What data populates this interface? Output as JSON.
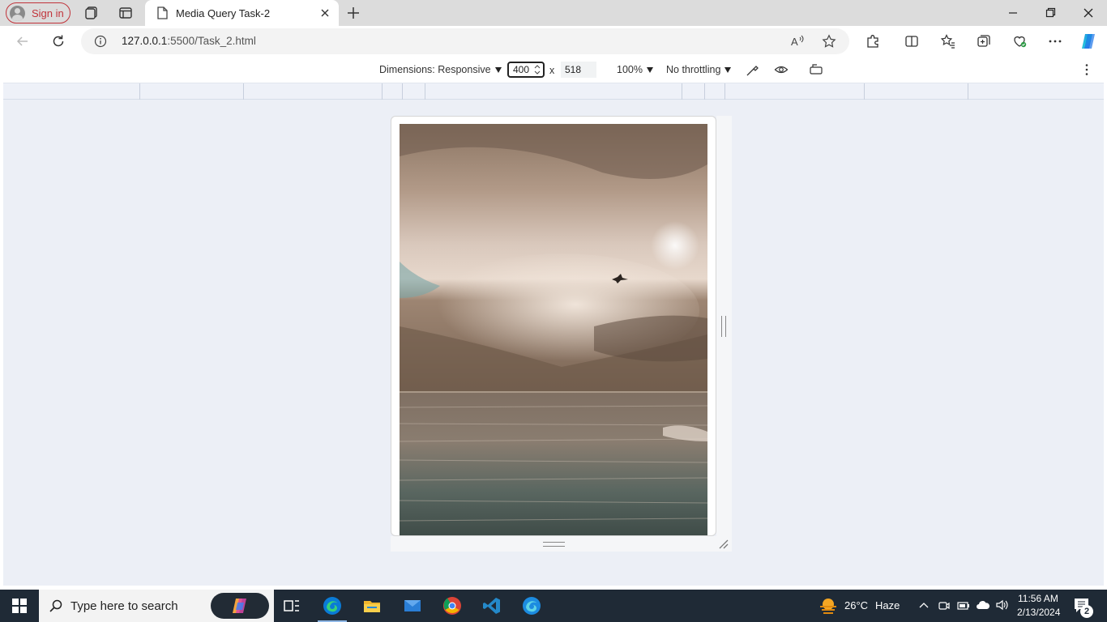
{
  "browser": {
    "sign_in_label": "Sign in",
    "tab_title": "Media Query Task-2",
    "url_host": "127.0.0.1",
    "url_path": ":5500/Task_2.html"
  },
  "devtools": {
    "dimensions_label": "Dimensions: Responsive",
    "width_value": "400",
    "times": "x",
    "height_value": "518",
    "zoom": "100%",
    "throttling": "No throttling"
  },
  "taskbar": {
    "search_placeholder": "Type here to search",
    "weather_temp": "26°C",
    "weather_desc": "Haze",
    "time": "11:56 AM",
    "date": "2/13/2024",
    "notification_count": "2"
  },
  "icons": {
    "tab_page": "page-icon",
    "omnibox_info": "info-icon",
    "brand_accent": "#c1343b",
    "edge_blue": "#0a7bd6"
  }
}
